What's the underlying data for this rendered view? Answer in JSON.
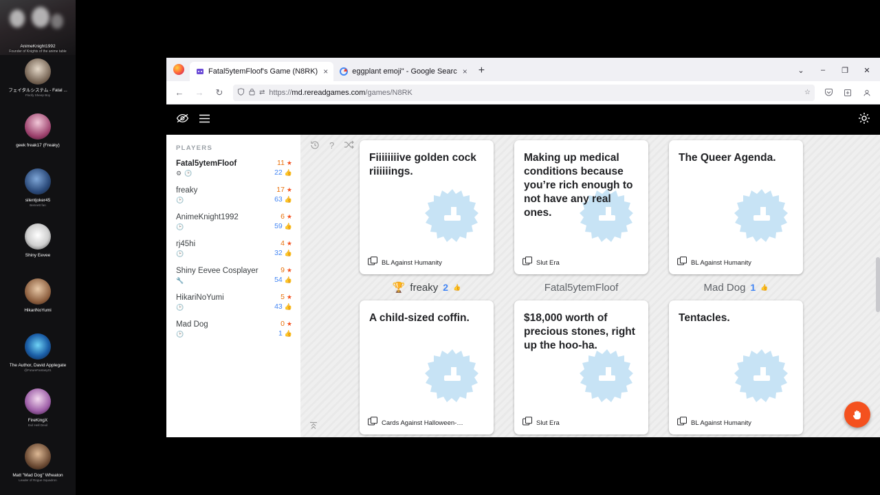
{
  "stream": {
    "webcam": {
      "name": "AnimeKnight1992",
      "sub": "Founder of Knights of the anime table"
    },
    "entries": [
      {
        "name": "フェイタルシステム - Fatal ...",
        "sub": "Floofy Sheep Boy"
      },
      {
        "name": "geek freak17 (Freaky)",
        "sub": ""
      },
      {
        "name": "silentjoker45",
        "sub": "Bennett fan"
      },
      {
        "name": "Shiny Eevee",
        "sub": ""
      },
      {
        "name": "HikariNoYumi",
        "sub": ""
      },
      {
        "name": "The Author, David Applegate",
        "sub": "@FutureFantasy01"
      },
      {
        "name": "FireKingX",
        "sub": "Evil Hell Devil"
      },
      {
        "name": "Matt \"Mad Dog\" Wheaton",
        "sub": "Leader of Rogue Squadron"
      }
    ]
  },
  "browser": {
    "tabs": [
      {
        "title": "Fatal5ytemFloof's Game (N8RK)",
        "favicon": "game-icon",
        "active": true,
        "close": "×"
      },
      {
        "title": "eggplant emoji\" - Google Searc",
        "favicon": "google-icon",
        "active": false,
        "close": "×"
      }
    ],
    "new_tab_label": "+",
    "window_controls": {
      "menu": "⌄",
      "minimize": "–",
      "maximize": "❐",
      "close": "✕"
    },
    "nav": {
      "back": "←",
      "forward": "→",
      "reload": "↻",
      "shield": "shield-icon",
      "lock": "lock-icon",
      "tracking": "⇄",
      "url_scheme": "https://",
      "url_host": "md.rereadgames.com",
      "url_path": "/games/N8RK",
      "bookmark": "☆",
      "pocket": "pocket-icon",
      "save": "save-icon",
      "account": "account-icon",
      "overflow": "»"
    }
  },
  "app": {
    "toolbar": {
      "hide_icon": "eye-slash-icon",
      "menu_icon": "hamburger-icon",
      "settings_icon": "gear-icon"
    },
    "players_title": "Players",
    "players": [
      {
        "name": "Fatal5ytemFloof",
        "bold": true,
        "badges": [
          "gear-icon",
          "clock-icon"
        ],
        "score": "11",
        "likes": "22"
      },
      {
        "name": "freaky",
        "bold": false,
        "badges": [
          "clock-icon"
        ],
        "score": "17",
        "likes": "63"
      },
      {
        "name": "AnimeKnight1992",
        "bold": false,
        "badges": [
          "clock-icon"
        ],
        "score": "6",
        "likes": "59"
      },
      {
        "name": "rj45hi",
        "bold": false,
        "badges": [
          "clock-icon"
        ],
        "score": "4",
        "likes": "32"
      },
      {
        "name": "Shiny Eevee Cosplayer",
        "bold": false,
        "badges": [
          "wrench-icon"
        ],
        "score": "9",
        "likes": "54"
      },
      {
        "name": "HikariNoYumi",
        "bold": false,
        "badges": [
          "clock-icon"
        ],
        "score": "5",
        "likes": "43"
      },
      {
        "name": "Mad Dog",
        "bold": false,
        "badges": [
          "clock-icon"
        ],
        "score": "0",
        "likes": "1"
      }
    ],
    "board_tools": {
      "history_icon": "history-icon",
      "help_icon": "question-icon",
      "shuffle_icon": "shuffle-icon",
      "collapse_icon": "collapse-icon"
    },
    "cards_top": [
      {
        "text": "Fiiiiiiiive golden cock riiiiiings.",
        "deck": "BL Against Humanity"
      },
      {
        "text": "Making up medical conditions because you’re rich enough to not have any real ones.",
        "deck": "Slut Era"
      },
      {
        "text": "The Queer Agenda.",
        "deck": "BL Against Humanity"
      }
    ],
    "winners": [
      {
        "name": "freaky",
        "count": "2",
        "trophy": true
      },
      {
        "name": "Fatal5ytemFloof",
        "count": "",
        "trophy": false
      },
      {
        "name": "Mad Dog",
        "count": "1",
        "trophy": false
      }
    ],
    "cards_bottom": [
      {
        "text": "A child-sized coffin.",
        "deck": "Cards Against Halloween-…"
      },
      {
        "text": "$18,000 worth of precious stones, right up the hoo-ha.",
        "deck": "Slut Era"
      },
      {
        "text": "Tentacles.",
        "deck": "BL Against Humanity"
      }
    ],
    "fab_icon": "hand-icon",
    "colors": {
      "accent_orange": "#f4511e",
      "accent_blue": "#4285f4",
      "appbar": "#000000"
    }
  }
}
